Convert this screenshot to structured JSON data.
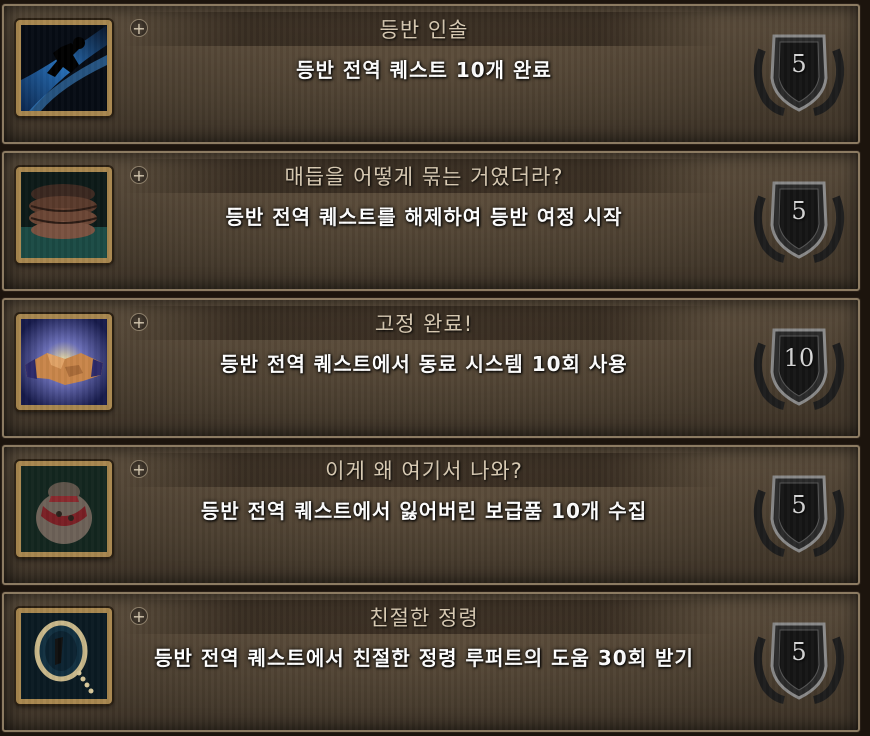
{
  "achievements": [
    {
      "title": "등반 인솔",
      "description": "등반 전역 퀘스트 10개 완료",
      "points": "5",
      "icon": "running-figure-icon"
    },
    {
      "title": "매듭을 어떻게 묶는 거였더라?",
      "description": "등반 전역 퀘스트를 해제하여 등반 여정 시작",
      "points": "5",
      "icon": "coiled-rope-icon"
    },
    {
      "title": "고정 완료!",
      "description": "등반 전역 퀘스트에서 동료 시스템 10회 사용",
      "points": "10",
      "icon": "handshake-icon"
    },
    {
      "title": "이게 왜 여기서 나와?",
      "description": "등반 전역 퀘스트에서 잃어버린 보급품 10개 수집",
      "points": "5",
      "icon": "supply-sack-icon"
    },
    {
      "title": "친절한 정령",
      "description": "등반 전역 퀘스트에서 친절한 정령 루퍼트의 도움 30회 받기",
      "points": "5",
      "icon": "spirit-mirror-icon"
    }
  ],
  "expand_symbol": "+"
}
